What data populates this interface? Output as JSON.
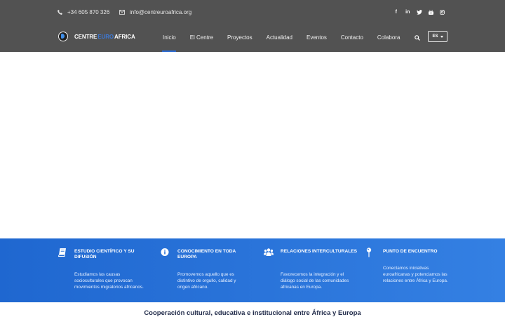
{
  "topbar": {
    "phone": "+34 605 870 326",
    "email": "info@centreuroafrica.org",
    "social": [
      "f",
      "in",
      "t",
      "y",
      "ig"
    ]
  },
  "brand": {
    "part1": "CENTRE",
    "part2": "EURO",
    "part3": "AFRICA"
  },
  "nav": {
    "items": [
      "Inicio",
      "El Centre",
      "Proyectos",
      "Actualidad",
      "Eventos",
      "Contacto",
      "Colabora"
    ],
    "active": "Inicio",
    "lang": "ES"
  },
  "features": [
    {
      "icon": "book-icon",
      "title": "ESTUDIO CIENTÍFICO Y SU DIFUSIÓN",
      "text": "Estudiamos las causas socioculturales que provocan movimientos migratorios africanos."
    },
    {
      "icon": "info-icon",
      "title": "CONOCIMIENTO EN TODA EUROPA",
      "text": "Promovemos aquello que es distintivo de orgullo, calidad y origen africano."
    },
    {
      "icon": "users-icon",
      "title": "RELACIONES INTERCULTURALES",
      "text": "Favorecemos la integración y el diálogo social de las comunidades africanas en Europa."
    },
    {
      "icon": "pin-icon",
      "title": "PUNTO DE ENCUENTRO",
      "text": "Conectamos iniciativas euroafricanas y potenciamos las relaciones entre África y Europa."
    }
  ],
  "section": {
    "title": "Cooperación cultural, educativa e institucional entre África y Europa"
  },
  "colors": {
    "header": "#525252",
    "accent": "#2d6bd1",
    "features_start": "#1f67d0",
    "features_end": "#3480e3"
  }
}
